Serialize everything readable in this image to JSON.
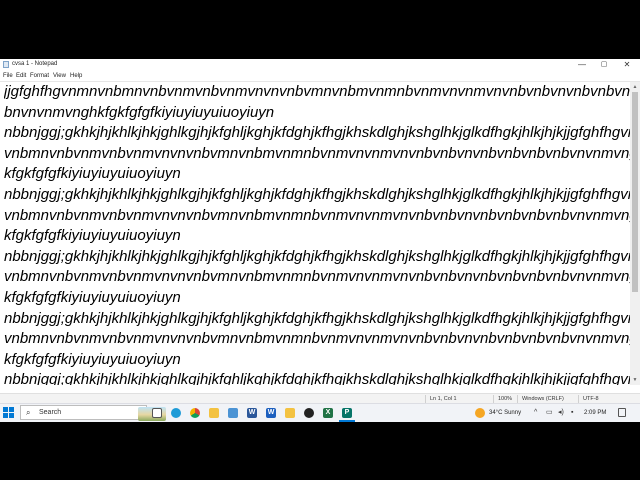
{
  "window": {
    "title": "cvsa 1 - Notepad",
    "controls": {
      "minimize": "—",
      "maximize": "▢",
      "close": "✕"
    }
  },
  "menu": [
    "File",
    "Edit",
    "Format",
    "View",
    "Help"
  ],
  "editor": {
    "lines": [
      "jjgfghfhgvnmnvnbmnvnbvnmvnbvnmvnvnvnbvmnvnbmvnmnbvnmvnvnmvnvnbvnbvnvnbvnbvnbvnbvnbvn",
      "bnvnvnmvnghkfgkfgfgfkiyiuyiuyuiuoyiuyn",
      "nbbnjggj;gkhkjhjkhlkjhkjghlkgjhjkfghljkghjkfdghjkfhgjkhskdlghjkshglhkjglkdfhgkjhlkjhjkjjgfghfhgvnmn",
      "vnbmnvnbvnmvnbvnmvnvnvnbvmnvnbmvnmnbvnmvnvnmvnvnbvnbvnvnbvnbvnbvnbvnvnmvngh",
      "kfgkfgfgfkiyiuyiuyuiuoyiuyn",
      "nbbnjggj;gkhkjhjkhlkjhkjghlkgjhjkfghljkghjkfdghjkfhgjkhskdlghjkshglhkjglkdfhgkjhlkjhjkjjgfghfhgvnmn",
      "vnbmnvnbvnmvnbvnmvnvnvnbvmnvnbmvnmnbvnmvnvnmvnvnbvnbvnvnbvnbvnbvnbvnvnmvngh",
      "kfgkfgfgfkiyiuyiuyuiuoyiuyn",
      "nbbnjggj;gkhkjhjkhlkjhkjghlkgjhjkfghljkghjkfdghjkfhgjkhskdlghjkshglhkjglkdfhgkjhlkjhjkjjgfghfhgvnmn",
      "vnbmnvnbvnmvnbvnmvnvnvnbvmnvnbmvnmnbvnmvnvnmvnvnbvnbvnvnbvnbvnbvnbvnvnmvngh",
      "kfgkfgfgfkiyiuyiuyuiuoyiuyn",
      "nbbnjggj;gkhkjhjkhlkjhkjghlkgjhjkfghljkghjkfdghjkfhgjkhskdlghjkshglhkjglkdfhgkjhlkjhjkjjgfghfhgvnmn",
      "vnbmnvnbvnmvnbvnmvnvnvnbvmnvnbmvnmnbvnmvnvnmvnvnbvnbvnvnbvnbvnbvnbvnvnmvngh",
      "kfgkfgfgfkiyiuyiuyuiuoyiuyn",
      "nbbnjggj;gkhkjhjkhlkjhkjghlkgjhjkfghljkghjkfdghjkfhgjkhskdlghjkshglhkjglkdfhgkjhlkjhjkjjgfghfhgvnmn"
    ]
  },
  "status": {
    "position": "Ln 1, Col 1",
    "zoom": "100%",
    "line_ending": "Windows (CRLF)",
    "encoding": "UTF-8"
  },
  "taskbar": {
    "search_placeholder": "Search",
    "weather": "34°C  Sunny",
    "time": "2:09 PM",
    "pinned_icons": [
      "task-view-icon",
      "edge-icon",
      "chrome-icon",
      "file-explorer-icon",
      "store-icon",
      "word-icon",
      "file-explorer-icon",
      "media-icon",
      "excel-icon",
      "publisher-icon"
    ],
    "colors": {
      "accent": "#0078d4",
      "sun": "#f5a623"
    }
  }
}
